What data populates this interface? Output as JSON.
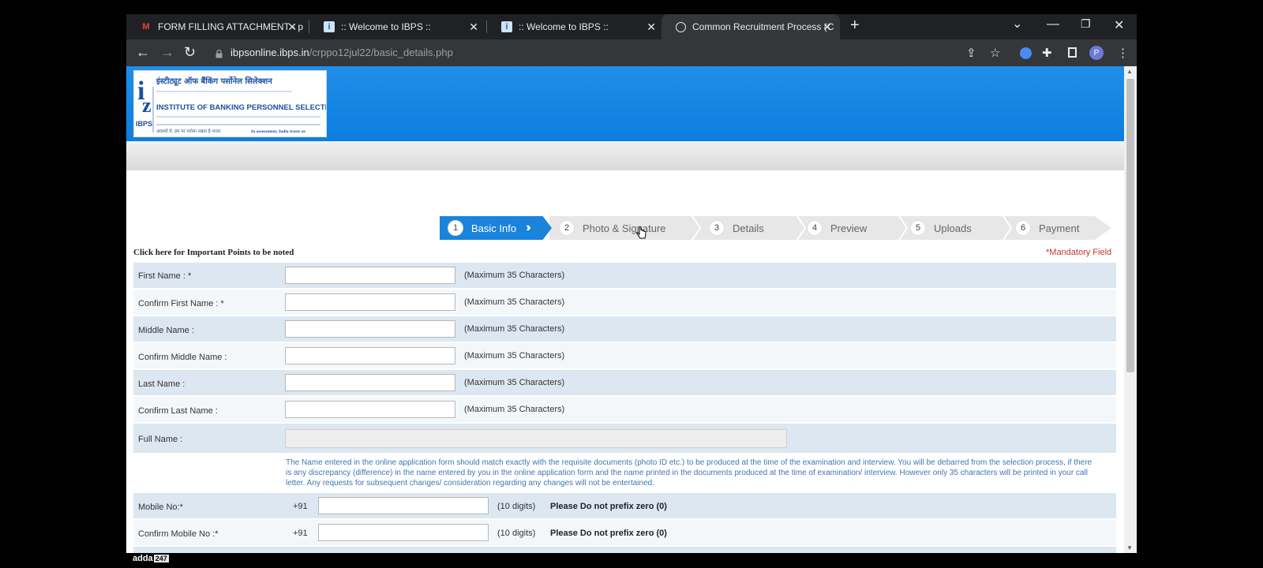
{
  "browser": {
    "tabs": [
      {
        "title": "FORM FILLING ATTACHMENT - p",
        "icon": "gmail-icon"
      },
      {
        "title": ":: Welcome to IBPS ::",
        "icon": "ibps-favicon-icon"
      },
      {
        "title": ":: Welcome to IBPS ::",
        "icon": "ibps-favicon-icon"
      },
      {
        "title": "Common Recruitment Process (C",
        "icon": "globe-icon"
      }
    ],
    "url_domain": "ibpsonline.ibps.in",
    "url_path": "/crppo12jul22/basic_details.php",
    "profile_initial": "P"
  },
  "logo": {
    "hindi_name": "इंस्टीट्यूट ऑफ बैंकिंग पर्सोनेल सिलेक्शन",
    "english_name": "INSTITUTE OF BANKING PERSONNEL SELECTION",
    "short": "IBPS",
    "tagline_left": "अवसरों में, हम पर भरोसा रखता है भारत",
    "tagline_right": "In assessment, India trusts us"
  },
  "steps": [
    {
      "num": "1",
      "label": "Basic Info"
    },
    {
      "num": "2",
      "label": "Photo & Signature"
    },
    {
      "num": "3",
      "label": "Details"
    },
    {
      "num": "4",
      "label": "Preview"
    },
    {
      "num": "5",
      "label": "Uploads"
    },
    {
      "num": "6",
      "label": "Payment"
    }
  ],
  "important_link": "Click here for Important Points to be noted",
  "mandatory": "*Mandatory Field",
  "fields": [
    {
      "label": "First Name : *",
      "hint": "(Maximum 35 Characters)"
    },
    {
      "label": "Confirm First Name : *",
      "hint": "(Maximum 35 Characters)"
    },
    {
      "label": "Middle Name :",
      "hint": "(Maximum 35 Characters)"
    },
    {
      "label": "Confirm Middle Name :",
      "hint": "(Maximum 35 Characters)"
    },
    {
      "label": "Last Name :",
      "hint": "(Maximum 35 Characters)"
    },
    {
      "label": "Confirm Last Name :",
      "hint": "(Maximum 35 Characters)"
    }
  ],
  "full_name": {
    "label": "Full Name :",
    "note": "The Name entered in the online application form should match exactly with the requisite documents (photo ID etc.) to be produced at the time of the examination and interview. You will be debarred from the selection process, if there is any discrepancy (difference) in the name entered by you in the online application form and the name printed in the documents produced at the time of examination/ interview. However only 35 characters will be printed in your call letter. Any requests for subsequent changes/ consideration regarding any changes will not be entertained."
  },
  "mobile": [
    {
      "label": "Mobile No:*",
      "prefix": "+91",
      "digits": "(10 digits)",
      "warning": "Please Do not prefix zero (0)"
    },
    {
      "label": "Confirm Mobile No :*",
      "prefix": "+91",
      "digits": "(10 digits)",
      "warning": "Please Do not prefix zero (0)"
    }
  ],
  "watermark": {
    "text": "adda",
    "box": "247"
  }
}
